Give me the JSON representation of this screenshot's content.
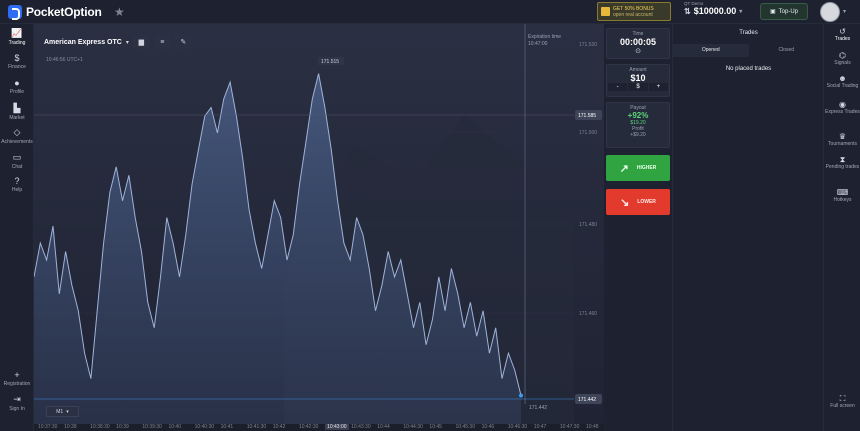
{
  "header": {
    "logo_text": "PocketOption",
    "bonus_line1": "GET 50% BONUS",
    "bonus_line2": "open real account",
    "account_label": "QT Demo",
    "balance": "$10000.00",
    "topup_label": "Top-Up"
  },
  "left_nav": [
    {
      "label": "Trading",
      "icon": "chart-line-icon"
    },
    {
      "label": "Finance",
      "icon": "dollar-icon"
    },
    {
      "label": "Profile",
      "icon": "user-icon"
    },
    {
      "label": "Market",
      "icon": "cart-icon"
    },
    {
      "label": "Achievements",
      "icon": "diamond-icon"
    },
    {
      "label": "Chat",
      "icon": "chat-icon"
    },
    {
      "label": "Help",
      "icon": "help-icon"
    }
  ],
  "left_nav_bottom": [
    {
      "label": "Registration",
      "icon": "add-user-icon"
    },
    {
      "label": "Sign In",
      "icon": "sign-in-icon"
    }
  ],
  "chart": {
    "asset": "American Express OTC",
    "clock": "10:46:56 UTC+1",
    "expiration_label": "Expiration time",
    "expiration_time": "10:47:00",
    "timeframe": "M1",
    "current_price": "171.442",
    "price_marker": "171.585",
    "peak_label": "171.515"
  },
  "chart_data": {
    "type": "area",
    "y_ticks": [
      "171.520",
      "171.500",
      "171.480",
      "171.460"
    ],
    "x_ticks": [
      "10:37:30",
      "10:38",
      "10:38:30",
      "10:39",
      "10:39:30",
      "10:40",
      "10:40:30",
      "10:41",
      "10:41:30",
      "10:42",
      "10:42:30",
      "10:43:00",
      "10:43:30",
      "10:44",
      "10:44:30",
      "10:45",
      "10:45:30",
      "10:46",
      "10:46:30",
      "10:47",
      "10:47:30",
      "10:48"
    ],
    "x_highlight": "10:43:00",
    "ylim": [
      171.44,
      171.525
    ],
    "values": [
      171.47,
      171.478,
      171.474,
      171.482,
      171.466,
      171.476,
      171.468,
      171.462,
      171.452,
      171.446,
      171.462,
      171.478,
      171.49,
      171.496,
      171.488,
      171.494,
      171.484,
      171.476,
      171.464,
      171.458,
      171.47,
      171.484,
      171.478,
      171.47,
      171.48,
      171.492,
      171.5,
      171.508,
      171.51,
      171.504,
      171.512,
      171.516,
      171.508,
      171.498,
      171.486,
      171.478,
      171.472,
      171.48,
      171.488,
      171.484,
      171.474,
      171.48,
      171.492,
      171.502,
      171.512,
      171.518,
      171.51,
      171.5,
      171.488,
      171.478,
      171.474,
      171.484,
      171.48,
      171.472,
      171.462,
      171.468,
      171.476,
      171.47,
      171.474,
      171.466,
      171.458,
      171.464,
      171.454,
      171.46,
      171.47,
      171.462,
      171.472,
      171.466,
      171.458,
      171.464,
      171.456,
      171.462,
      171.452,
      171.458,
      171.446,
      171.452,
      171.448,
      171.442
    ]
  },
  "trade_panel": {
    "time_label": "Time",
    "time_value": "00:00:05",
    "amount_label": "Amount",
    "amount_value": "$10",
    "minus": "-",
    "currency": "$",
    "plus": "+",
    "payout_label": "Payout",
    "payout_pct": "+92%",
    "payout_amount": "$19.20",
    "profit_label": "Profit",
    "profit_value": "+$9.20",
    "higher_label": "HIGHER",
    "lower_label": "LOWER"
  },
  "trades": {
    "title": "Trades",
    "tab_opened": "Opened",
    "tab_closed": "Closed",
    "empty_text": "No placed trades"
  },
  "right_nav": [
    {
      "label": "Trades",
      "icon": "history-icon"
    },
    {
      "label": "Signals",
      "icon": "signals-icon"
    },
    {
      "label": "Social Trading",
      "icon": "social-icon"
    },
    {
      "label": "Express Trades",
      "icon": "express-icon"
    },
    {
      "label": "Tournaments",
      "icon": "trophy-icon"
    },
    {
      "label": "Pending trades",
      "icon": "hourglass-icon"
    },
    {
      "label": "Hotkeys",
      "icon": "keyboard-icon"
    }
  ],
  "right_nav_bottom": {
    "label": "Full screen",
    "icon": "fullscreen-icon"
  }
}
